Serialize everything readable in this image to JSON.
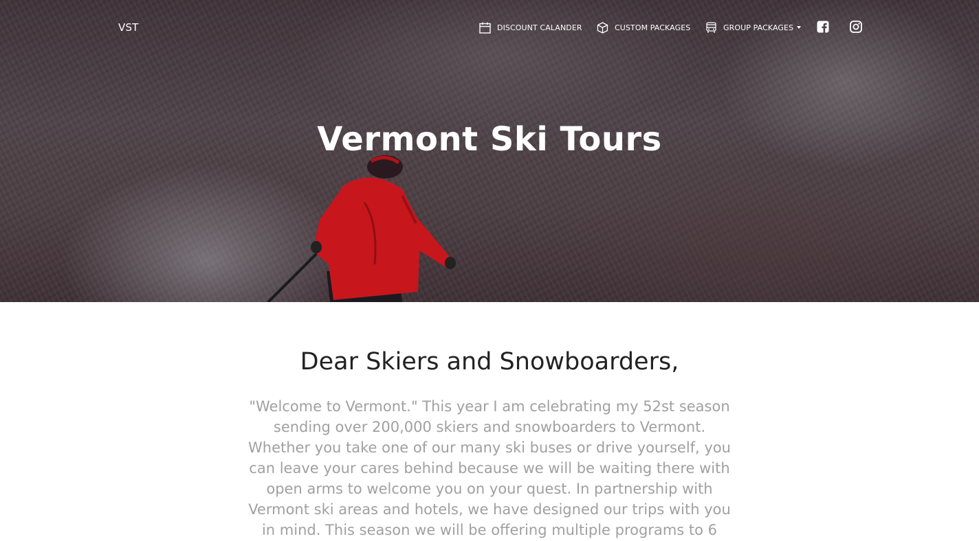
{
  "nav": {
    "brand": "VST",
    "items": [
      {
        "label": "DISCOUNT CALANDER",
        "icon": "calendar-icon"
      },
      {
        "label": "CUSTOM PACKAGES",
        "icon": "box-icon"
      },
      {
        "label": "GROUP PACKAGES",
        "icon": "bus-icon",
        "dropdown": true
      }
    ],
    "social": [
      {
        "icon": "facebook-icon"
      },
      {
        "icon": "instagram-icon"
      }
    ]
  },
  "hero": {
    "title": "Vermont Ski Tours"
  },
  "content": {
    "greeting": "Dear Skiers and Snowboarders,",
    "intro": "\"Welcome to Vermont.\" This year I am celebrating my 52st season sending over 200,000 skiers and snowboarders to Vermont. Whether you take one of our many ski buses or drive yourself, you can leave your cares behind because we will be waiting there with open arms to welcome you on your quest. In partnership with Vermont ski areas and hotels, we have designed our trips with you in mind. This season we will be offering multiple programs to 6"
  },
  "colors": {
    "nav_text": "#ffffff",
    "heading_text": "#222222",
    "body_text": "#a0a0a0",
    "skier_jacket": "#c8161d"
  }
}
